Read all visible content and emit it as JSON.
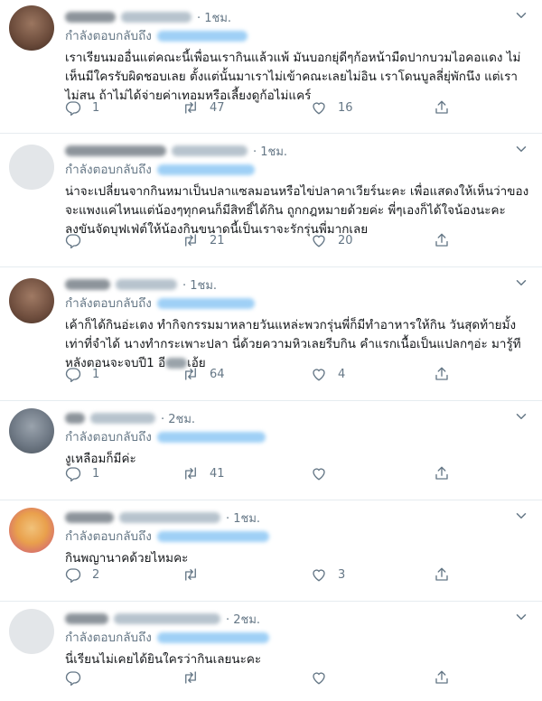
{
  "ui": {
    "reply_label": "กำลังตอบกลับถึง",
    "accent": "#1da1f2",
    "muted": "#657786"
  },
  "tweets": [
    {
      "time": "· 1ชม.",
      "text": "เราเรียนมออื่นแต่คณะนี้เพื่อนเรากินแล้วแพ้ มันบอกยุ่ดีๆก้อหน้ามืดปากบวมไอคอแดง ไม่เห็นมีใครรับผิดชอบเลย ตั้งแต่นั้นมาเราไม่เข้าคณะเลยไม่อิน เราโดนบูลลี่ยุ่พักนึง แต่เราไม่สน ถ้าไม่ได้จ่ายค่าเทอมหรือเลี้ยงดูก้อไม่แคร์",
      "replies": "1",
      "retweets": "47",
      "likes": "16"
    },
    {
      "time": "· 1ชม.",
      "text": "น่าจะเปลี่ยนจากกินหมาเป็นปลาแซลมอนหรือไข่ปลาคาเวียร์นะคะ เพื่อแสดงให้เห็นว่าของจะแพงแค่ไหนแต่น้องๆทุกคนก็มีสิทธิ์ได้กิน ถูกกฎหมายด้วยค่ะ พี่ๆเองก็ได้ใจน้องนะคะ ลงขันจัดบุฟเฟ่ต์ให้น้องกินขนาดนี้เป็นเราจะรักรุ่นพี่มากเลย",
      "replies": "",
      "retweets": "21",
      "likes": "20"
    },
    {
      "time": "· 1ชม.",
      "text_before": "เค้าก็ได้กินอ่ะเตง ทำกิจกรรมมาหลายวันแหล่ะพวกรุ่นพี่ก็มีทำอาหารให้กิน วันสุดท้ายมั้งเท่าที่จำได้ นางทำกระเพาะปลา นี่ด้วยความหิวเลยรีบกิน คำแรกเนื้อเป็นแปลกๆอ่ะ มารู้ทีหลังตอนจะจบปี1 อี",
      "text_after": "เอ้ย",
      "replies": "1",
      "retweets": "64",
      "likes": "4"
    },
    {
      "time": "· 2ชม.",
      "text": "งูเหลือมก็มีค่ะ",
      "replies": "1",
      "retweets": "41",
      "likes": ""
    },
    {
      "time": "· 1ชม.",
      "text": "กินพญานาคด้วยไหมคะ",
      "replies": "2",
      "retweets": "",
      "likes": "3"
    },
    {
      "time": "· 2ชม.",
      "text": "นี่เรียนไม่เคยได้ยินใครว่ากินเลยนะคะ",
      "replies": "",
      "retweets": "",
      "likes": ""
    }
  ]
}
